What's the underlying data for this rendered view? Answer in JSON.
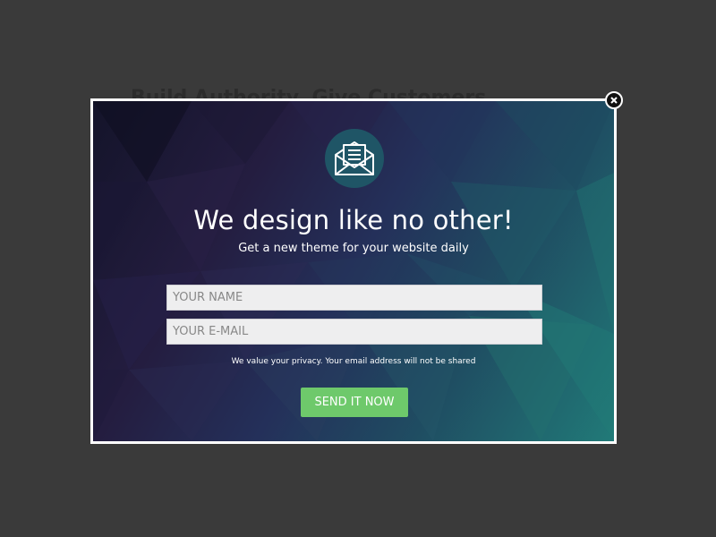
{
  "background": {
    "heading": "Build Authority, Give Customers"
  },
  "modal": {
    "icon": "envelope-letter-icon",
    "title": "We design like no other!",
    "subtitle": "Get a new theme for your website daily",
    "name_field": {
      "placeholder": "YOUR NAME",
      "value": ""
    },
    "email_field": {
      "placeholder": "YOUR E-MAIL",
      "value": ""
    },
    "privacy_note": "We value your privacy. Your email address will not be shared",
    "submit_label": "SEND IT NOW",
    "close_icon": "close-icon"
  },
  "colors": {
    "page_background": "#3a3a3a",
    "modal_border": "#ffffff",
    "icon_circle": "#1f5566",
    "submit_button": "#6ec96b",
    "input_background": "#eeeeef"
  }
}
